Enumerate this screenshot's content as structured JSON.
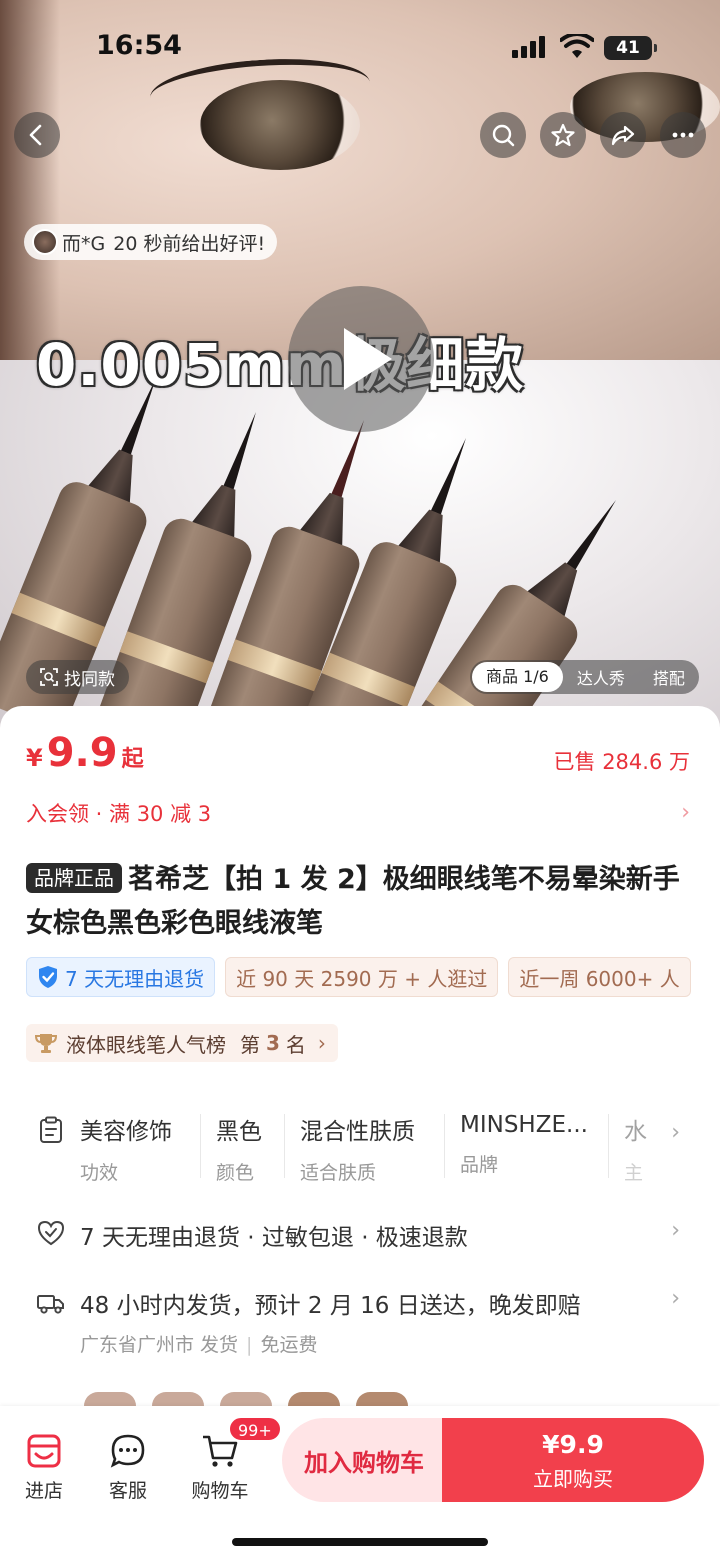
{
  "status": {
    "time": "16:54",
    "battery": "41"
  },
  "hero": {
    "review_user": "而*G",
    "review_text": "20 秒前给出好评!",
    "caption": "0.005mm极细款",
    "find_same": "找同款",
    "media_tabs": [
      "商品 1/6",
      "达人秀",
      "搭配"
    ]
  },
  "product": {
    "price_symbol": "¥",
    "price": "9.9",
    "price_suffix": "起",
    "sold": "已售 284.6 万",
    "promo": "入会领 · 满 30 减 3",
    "brand_tag": "品牌正品",
    "title": "茗希芝【拍 1 发 2】极细眼线笔不易晕染新手女棕色黑色彩色眼线液笔",
    "chips": [
      "7 天无理由退货",
      "近 90 天 2590 万 + 人逛过",
      "近一周 6000+ 人"
    ],
    "rank": {
      "prefix": "液体眼线笔人气榜",
      "di": "第",
      "num": "3",
      "ming": "名"
    }
  },
  "attributes": [
    {
      "value": "美容修饰",
      "key": "功效"
    },
    {
      "value": "黑色",
      "key": "颜色"
    },
    {
      "value": "混合性肤质",
      "key": "适合肤质"
    },
    {
      "value": "MINSHZE...",
      "key": "品牌"
    },
    {
      "value": "水",
      "key": "主"
    }
  ],
  "services": {
    "returns": "7 天无理由退货 · 过敏包退 · 极速退款",
    "shipping": "48 小时内发货，预计 2 月 16 日送达，晚发即赔",
    "origin": "广东省广州市 发货",
    "freight": "免运费"
  },
  "bottom_bar": {
    "store": "进店",
    "service": "客服",
    "cart": "购物车",
    "cart_badge": "99+",
    "add_to_cart": "加入购物车",
    "buy_price": "¥9.9",
    "buy_now": "立即购买"
  },
  "colors": {
    "accent": "#e8313a",
    "buy_button": "#f2404c",
    "cart_button_bg": "#ffe4e6"
  }
}
